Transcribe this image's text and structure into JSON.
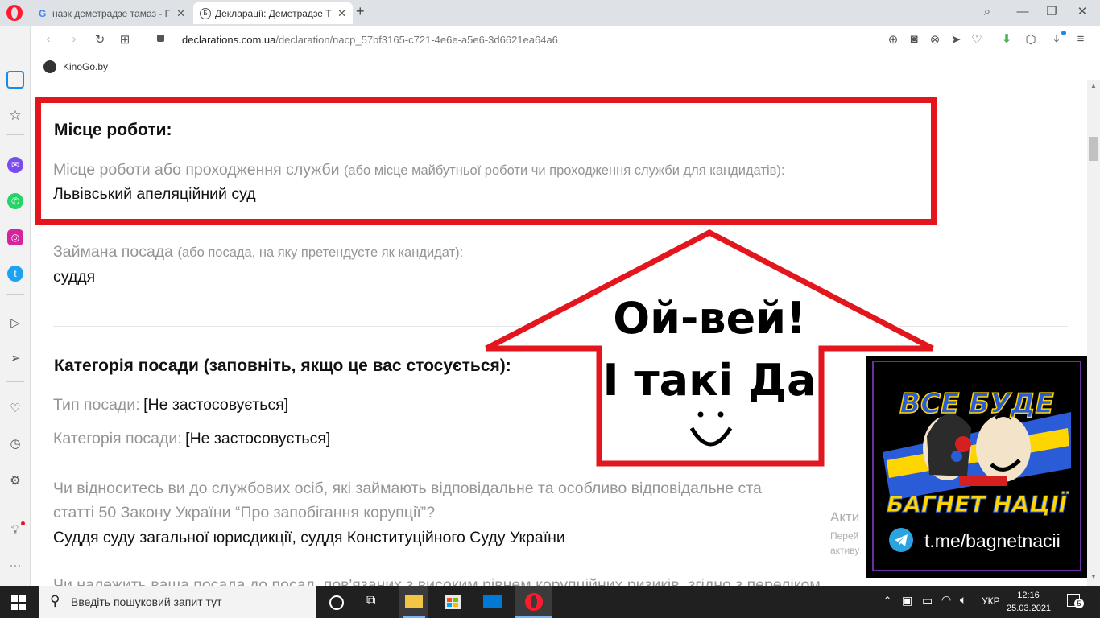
{
  "browser": {
    "tabs": [
      {
        "label": "назк деметрадзе тамаз - Г",
        "active": false
      },
      {
        "label": "Декларації: Деметрадзе Т",
        "active": true
      }
    ],
    "url_domain": "declarations.com.ua",
    "url_path": "/declaration/nacp_57bf3165-c721-4e6e-a5e6-3d6621ea64a6",
    "bookmark": "KinoGo.by"
  },
  "content": {
    "workplace_heading": "Місце роботи:",
    "workplace_label": "Місце роботи або проходження служби",
    "workplace_label_note": "(або місце майбутньої роботи чи проходження служби для кандидатів):",
    "workplace_value": "Львівський апеляційний суд",
    "position_label": "Займана посада",
    "position_label_note": "(або посада, на яку претендуєте як кандидат):",
    "position_value": "суддя",
    "category_heading": "Категорія посади (заповніть, якщо це вас стосується):",
    "type_label": "Тип посади:",
    "type_value": "[Не застосовується]",
    "category_label": "Категорія посади:",
    "category_value": "[Не застосовується]",
    "question_line1": "Чи відноситесь ви до службових осіб, які займають відповідальне та особливо відповідальне ста",
    "question_line2": "статті 50 Закону України “Про запобігання корупції”?",
    "question_answer": "Суддя суду загальної юрисдикції, суддя Конституційного Суду України",
    "cut_line": "Чи належить ваша посада до посад, пов'язаних з високим рівнем корупційних ризиків, згідно з переліком"
  },
  "overlay": {
    "arrow_line1": "Ой-вей!",
    "arrow_line2": "І такі Да",
    "watermark1": "Акти",
    "watermark2": "Перей",
    "watermark3": "активу",
    "badge_line1": "ВСЕ БУДЕ",
    "badge_line2": "БАГНЕТ НАЦІЇ",
    "badge_link": "t.me/bagnetnacii"
  },
  "taskbar": {
    "search_placeholder": "Введіть пошуковий запит тут",
    "language": "УКР",
    "time": "12:16",
    "date": "25.03.2021",
    "notifications": "5"
  },
  "colors": {
    "highlight_red": "#e3161d",
    "badge_border": "#6a2fa0",
    "badge_blue": "#2a5cd8",
    "badge_yellow": "#ffd500"
  }
}
